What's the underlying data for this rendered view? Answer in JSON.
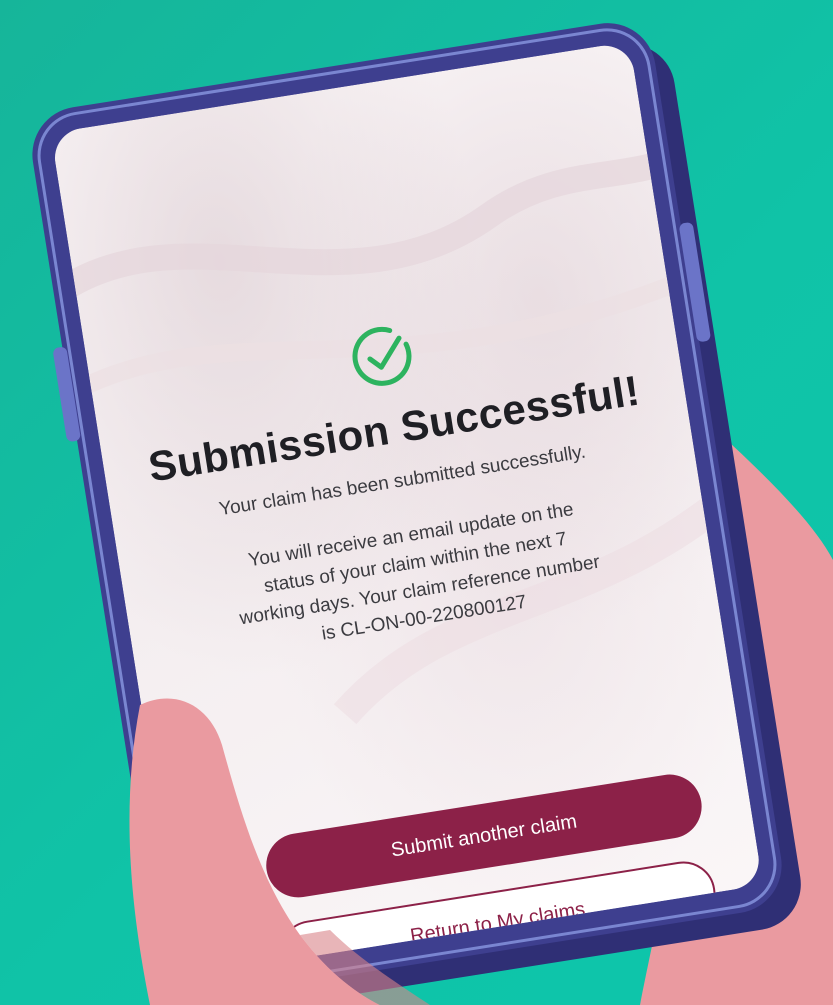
{
  "screen": {
    "title": "Submission Successful!",
    "subtitle": "Your claim has been submitted successfully.",
    "body_line1": "You will receive an email update on the",
    "body_line2": "status of your claim within the next  7",
    "body_line3": "working days. Your claim reference number",
    "body_line4": "is CL-ON-00-220800127",
    "primary_button": "Submit another claim",
    "secondary_button": "Return to My claims"
  },
  "colors": {
    "background": "#10c3a7",
    "phone_body": "#3e3f8f",
    "accent": "#8c2148",
    "success": "#2db35f",
    "hand": "#ea9aa0"
  },
  "icons": {
    "success": "check-circle-icon"
  }
}
